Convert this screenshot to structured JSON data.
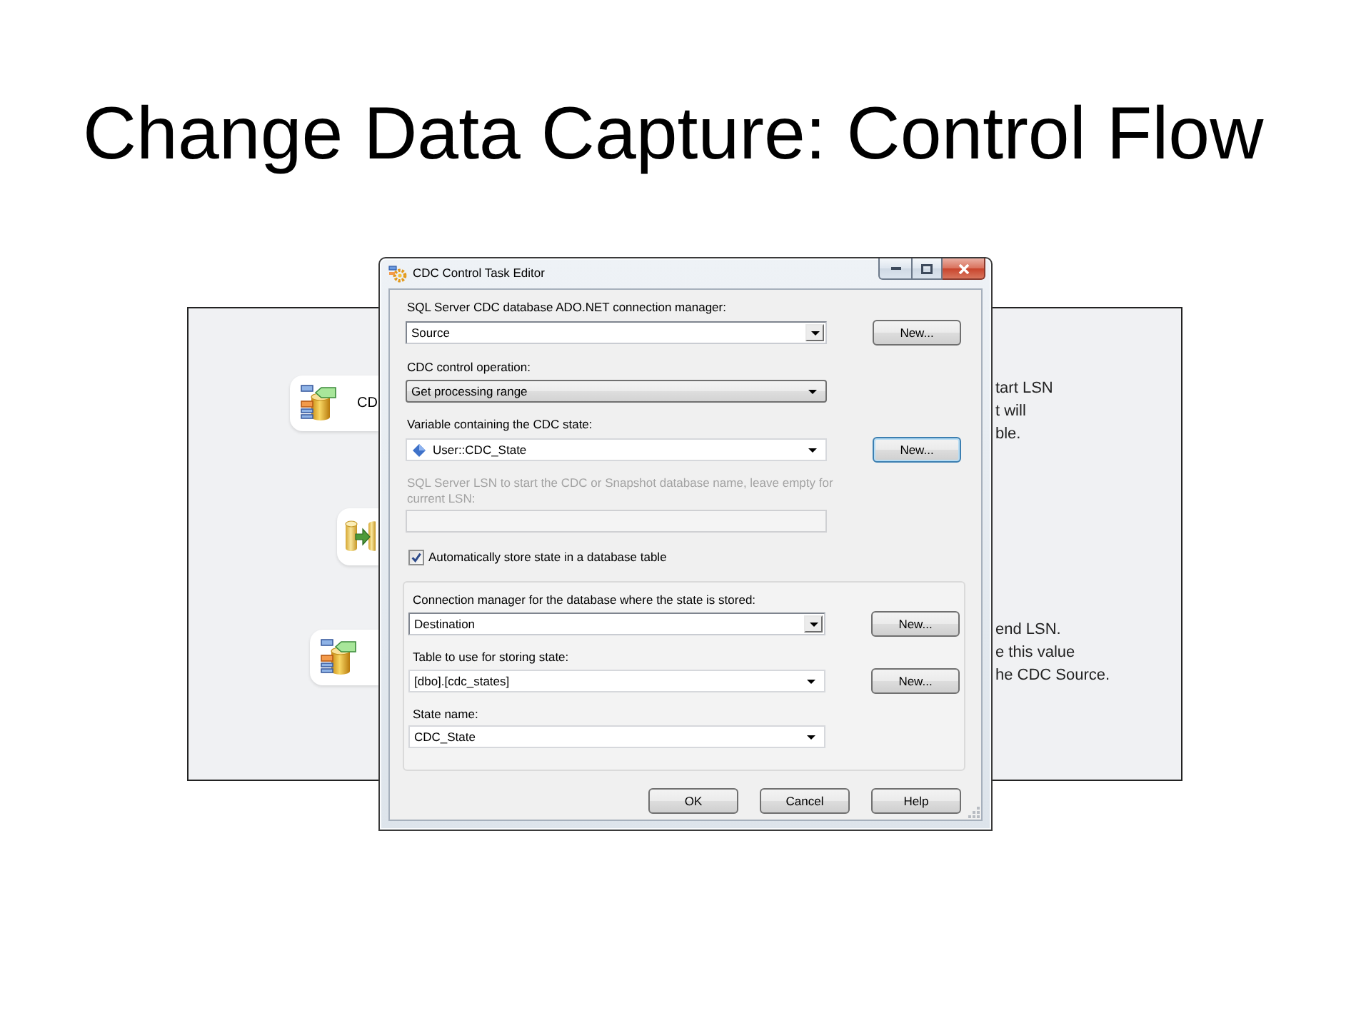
{
  "slide": {
    "title": "Change Data Capture: Control Flow"
  },
  "canvas": {
    "nodes": [
      {
        "kind": "cdc",
        "label": "CD"
      },
      {
        "kind": "flow"
      },
      {
        "kind": "cdc"
      }
    ],
    "notes": [
      {
        "lines": [
          "tart LSN",
          "t will",
          "ble."
        ]
      },
      {
        "lines": [
          "end LSN.",
          "e this value",
          "he CDC Source."
        ]
      }
    ]
  },
  "dialog": {
    "title": "CDC Control Task Editor",
    "fields": [
      {
        "kind": "combo",
        "label": "SQL Server CDC database ADO.NET connection manager:",
        "value": "Source",
        "disabled": false,
        "button": {
          "label": "New...",
          "focused": false
        }
      },
      {
        "kind": "list",
        "label": "CDC control operation:",
        "value": "Get processing range",
        "disabled": false
      },
      {
        "kind": "variable",
        "label": "Variable containing the CDC state:",
        "value": "User::CDC_State",
        "disabled": false,
        "button": {
          "label": "New...",
          "focused": true
        }
      },
      {
        "kind": "text",
        "label": "SQL Server LSN to start the CDC or Snapshot database name, leave empty for current LSN:",
        "disabled": true
      }
    ],
    "checkbox": {
      "label": "Automatically store state in a database table",
      "checked": true
    },
    "group": {
      "fields": [
        {
          "kind": "combo",
          "label": "Connection manager for the database where the state is stored:",
          "value": "Destination",
          "disabled": false,
          "button": {
            "label": "New...",
            "focused": false
          }
        },
        {
          "kind": "plain",
          "label": "Table to use for storing state:",
          "value": "[dbo].[cdc_states]",
          "disabled": false,
          "button": {
            "label": "New...",
            "focused": false
          }
        },
        {
          "kind": "plain",
          "label": "State name:",
          "value": "CDC_State",
          "disabled": false
        }
      ]
    },
    "buttons": [
      "OK",
      "Cancel",
      "Help"
    ]
  }
}
